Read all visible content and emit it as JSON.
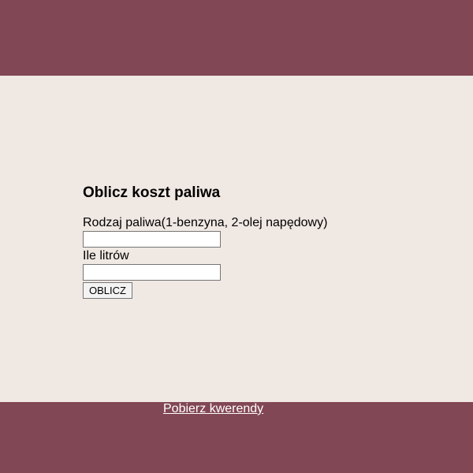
{
  "colors": {
    "band": "#824755",
    "main_background": "#f0e8e3",
    "link": "#ffffff"
  },
  "form": {
    "title": "Oblicz koszt paliwa",
    "fuel_type_label": "Rodzaj paliwa(1-benzyna, 2-olej napędowy)",
    "fuel_type_value": "",
    "liters_label": "Ile litrów",
    "liters_value": "",
    "submit_label": "OBLICZ"
  },
  "footer": {
    "link_text": "Pobierz kwerendy"
  }
}
